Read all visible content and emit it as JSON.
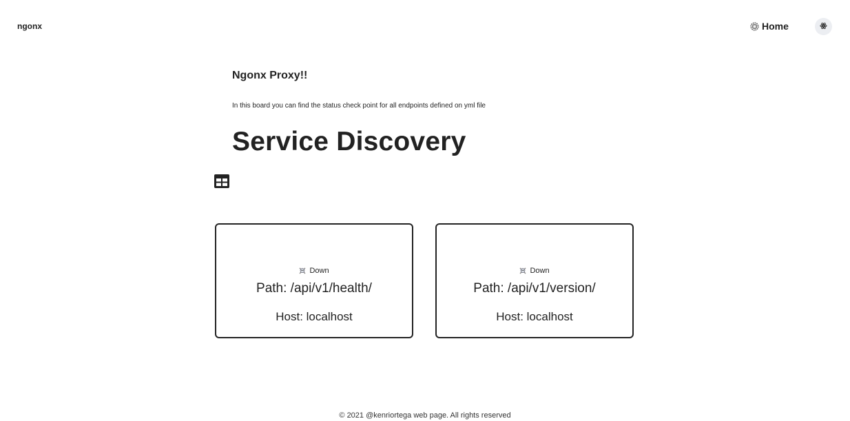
{
  "header": {
    "brand": "ngonx",
    "home_label": "Home",
    "home_icon": "gear-icon",
    "theme_icon": "atom-icon"
  },
  "intro": {
    "title": "Ngonx Proxy!!",
    "description": "In this board you can find the status check point for all endpoints defined on yml file"
  },
  "main": {
    "title": "Service Discovery",
    "view_icon": "table-grid-icon",
    "services": [
      {
        "status_icon": "skull-icon",
        "status": "Down",
        "path": "Path: /api/v1/health/",
        "host": "Host: localhost"
      },
      {
        "status_icon": "skull-icon",
        "status": "Down",
        "path": "Path: /api/v1/version/",
        "host": "Host: localhost"
      }
    ]
  },
  "footer": {
    "text": "© 2021 @kenriortega web page. All rights reserved"
  }
}
